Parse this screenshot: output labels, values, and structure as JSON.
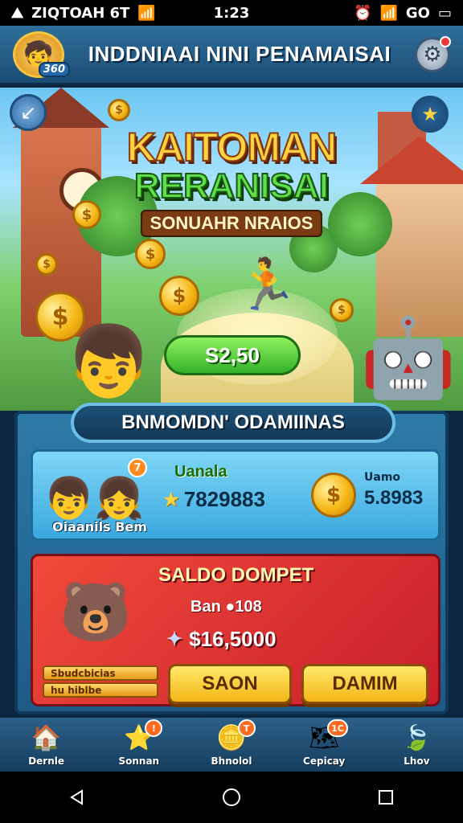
{
  "status_bar": {
    "left_text": "ZIQTOAH 6T",
    "time": "1:23",
    "battery_text": "GO"
  },
  "top_bar": {
    "title": "INDDNIAAI NINI PENAMAISAI",
    "avatar_level": "360"
  },
  "hero": {
    "title_line1": "KAITOMAN",
    "title_line2": "RERANISAI",
    "title_line3": "SONUAHR NRAIOS",
    "amount": "S2,50",
    "coin_symbol": "$"
  },
  "panel": {
    "header": "BNMOMDN' ODAMIINAS",
    "blue_card": {
      "caption": "Oiaanils Bem",
      "badge": "7",
      "label": "Uanala",
      "value": "7829883",
      "sublabel": "Uamo",
      "subvalue": "5.8983"
    },
    "red_card": {
      "title": "SALDO DOMPET",
      "line1": "Ban ●108",
      "line2": "$16,5000",
      "side_strips": [
        "Sbudcbicias",
        "hu hiblbe"
      ],
      "save_button": "SAON",
      "claim_button": "DAMIM"
    }
  },
  "bottom_nav": {
    "items": [
      {
        "label": "Dernle",
        "icon": "home-icon",
        "badge": ""
      },
      {
        "label": "Sonnan",
        "icon": "star-icon",
        "badge": "!"
      },
      {
        "label": "Bhnolol",
        "icon": "coin-icon",
        "badge": "T"
      },
      {
        "label": "Cepicay",
        "icon": "map-icon",
        "badge": "1C"
      },
      {
        "label": "Lhov",
        "icon": "leaf-icon",
        "badge": ""
      }
    ]
  },
  "colors": {
    "top_bar": "#2e6f9c",
    "accent_gold": "#ffd23f",
    "accent_green": "#5ee04a",
    "red_card": "#e03a36",
    "blue_card": "#39a8de"
  }
}
